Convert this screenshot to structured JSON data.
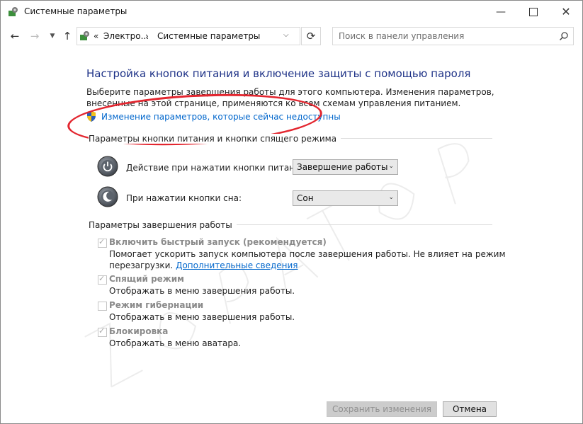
{
  "window": {
    "title": "Системные параметры",
    "controls": [
      "minimize",
      "maximize",
      "close"
    ]
  },
  "nav": {
    "back_icon": "arrow-left-icon",
    "forward_icon": "arrow-right-icon",
    "recent_icon": "chevron-down-icon",
    "up_icon": "arrow-up-icon"
  },
  "address": {
    "chevrons": "«",
    "crumb1": "Электро...",
    "sep": "›",
    "crumb2": "Системные параметры"
  },
  "search": {
    "placeholder": "Поиск в панели управления"
  },
  "main": {
    "heading": "Настройка кнопок питания и включение защиты с помощью пароля",
    "description": "Выберите параметры завершения работы для этого компьютера. Изменения параметров, внесенные на этой странице, применяются ко всем схемам управления питанием.",
    "change_link": "Изменение параметров, которые сейчас недоступны"
  },
  "buttons_group": {
    "title": "Параметры кнопки питания и кнопки спящего режима",
    "power": {
      "label": "Действие при нажатии кнопки питания:",
      "value": "Завершение работы"
    },
    "sleep": {
      "label": "При нажатии кнопки сна:",
      "value": "Сон"
    }
  },
  "shutdown_group": {
    "title": "Параметры завершения работы",
    "options": [
      {
        "title": "Включить быстрый запуск (рекомендуется)",
        "desc1": "Помогает ускорить запуск компьютера после завершения работы. Не влияет на режим",
        "desc2": "перезагрузки.",
        "link": "Дополнительные сведения",
        "checked": true
      },
      {
        "title": "Спящий режим",
        "desc1": "Отображать в меню завершения работы.",
        "checked": true
      },
      {
        "title": "Режим гибернации",
        "desc1": "Отображать в меню завершения работы.",
        "checked": false
      },
      {
        "title": "Блокировка",
        "desc1": "Отображать в меню аватара.",
        "checked": true
      }
    ]
  },
  "footer": {
    "save": "Сохранить изменения",
    "cancel": "Отмена"
  },
  "colors": {
    "heading": "#1e3287",
    "link": "#0066cc",
    "highlight_oval": "#e3262f"
  }
}
